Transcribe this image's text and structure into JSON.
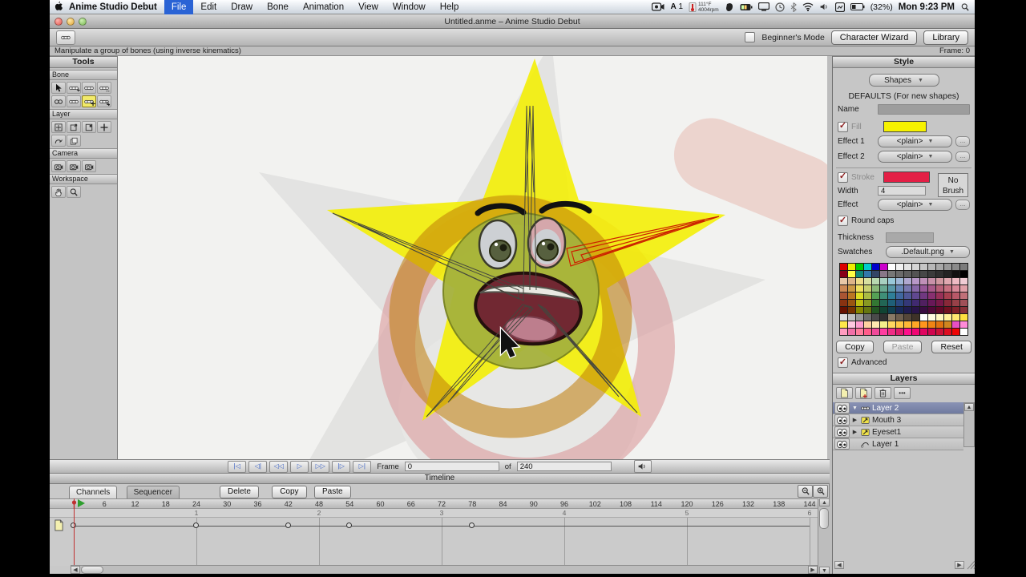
{
  "menu_bar": {
    "app_name": "Anime Studio Debut",
    "items": [
      {
        "label": "File",
        "selected": true
      },
      {
        "label": "Edit"
      },
      {
        "label": "Draw"
      },
      {
        "label": "Bone"
      },
      {
        "label": "Animation"
      },
      {
        "label": "View"
      },
      {
        "label": "Window"
      },
      {
        "label": "Help"
      }
    ],
    "status": {
      "adobe_label": "A",
      "adobe_count": "1",
      "temp_line1": "111°F",
      "temp_line2": "4004rpm",
      "battery_pct": "(32%)",
      "clock": "Mon 9:23 PM"
    }
  },
  "window": {
    "title": "Untitled.anme – Anime Studio Debut"
  },
  "toolbar": {
    "beginners_mode_label": "Beginner's Mode",
    "character_wizard_label": "Character Wizard",
    "library_label": "Library"
  },
  "status_bar": {
    "message": "Manipulate a group of bones (using inverse kinematics)",
    "frame_label": "Frame: 0"
  },
  "tools_panel": {
    "title": "Tools",
    "sections": [
      {
        "label": "Bone",
        "rows": [
          [
            {
              "name": "select-bone-tool",
              "sym": "cursor"
            },
            {
              "name": "translate-bone-tool",
              "sym": "bone",
              "badge": "+"
            },
            {
              "name": "rotate-bone-tool",
              "sym": "bone"
            },
            {
              "name": "scale-bone-tool",
              "sym": "bone",
              "badge": "↔"
            }
          ],
          [
            {
              "name": "add-bone-tool",
              "sym": "chain"
            },
            {
              "name": "bone-strength-tool",
              "sym": "bone"
            },
            {
              "name": "manipulate-bones-tool",
              "sym": "bone",
              "badge": "✛",
              "highlighted": true
            },
            {
              "name": "reparent-bone-tool",
              "sym": "bone",
              "badge": "↳"
            }
          ]
        ]
      },
      {
        "label": "Layer",
        "rows": [
          [
            {
              "name": "translate-layer-tool",
              "sym": "squarecross"
            },
            {
              "name": "rotate-layer-tool",
              "sym": "squarearrow"
            },
            {
              "name": "scale-layer-tool",
              "sym": "squaresmall"
            },
            {
              "name": "add-layer-tool",
              "sym": "plus"
            }
          ],
          [
            {
              "name": "rotate-layer-z-tool",
              "sym": "curvearrow"
            },
            {
              "name": "layer-order-tool",
              "sym": "layers"
            }
          ]
        ]
      },
      {
        "label": "Camera",
        "rows": [
          [
            {
              "name": "track-camera-tool",
              "sym": "camera"
            },
            {
              "name": "pan-camera-tool",
              "sym": "camera"
            },
            {
              "name": "roll-camera-tool",
              "sym": "camera"
            }
          ]
        ]
      },
      {
        "label": "Workspace",
        "rows": [
          [
            {
              "name": "pan-workspace-tool",
              "sym": "hand"
            },
            {
              "name": "zoom-workspace-tool",
              "sym": "magnifier"
            }
          ]
        ]
      }
    ]
  },
  "style_panel": {
    "title": "Style",
    "shapes_dropdown": "Shapes",
    "defaults_heading": "DEFAULTS (For new shapes)",
    "name_label": "Name",
    "fill_label": "Fill",
    "fill_color": "#f6f200",
    "effect1_label": "Effect 1",
    "effect1_value": "<plain>",
    "effect2_label": "Effect 2",
    "effect2_value": "<plain>",
    "stroke_label": "Stroke",
    "stroke_color": "#e31f45",
    "no_brush_line1": "No",
    "no_brush_line2": "Brush",
    "width_label": "Width",
    "width_value": "4",
    "effect_label": "Effect",
    "effect_value": "<plain>",
    "round_caps_label": "Round caps",
    "thickness_label": "Thickness",
    "swatches_label": "Swatches",
    "swatches_value": ".Default.png",
    "copy_label": "Copy",
    "paste_label": "Paste",
    "reset_label": "Reset",
    "advanced_label": "Advanced",
    "ellipsis": "..."
  },
  "palette_rows": [
    [
      "#dd0000",
      "#eeee00",
      "#00cc00",
      "#00cccc",
      "#0000cc",
      "#cc00cc",
      "#ffffff",
      "#f2f2f2",
      "#e4e4e4",
      "#d5d5d5",
      "#c6c6c6",
      "#b7b7b7",
      "#a8a8a8",
      "#999999",
      "#8a8a8a",
      "#7b7b7b"
    ],
    [
      "#880018",
      "#ffff44",
      "#118877",
      "#3377aa",
      "#334466",
      "#887788",
      "#777777",
      "#6b6b6b",
      "#5f5f5f",
      "#535353",
      "#474747",
      "#3b3b3b",
      "#2f2f2f",
      "#232323",
      "#111111",
      "#000000"
    ],
    [
      "#e8c8a8",
      "#ddb488",
      "#eedd88",
      "#d8e0a0",
      "#b8d8b0",
      "#a8d0c0",
      "#98c8d8",
      "#a0b8d8",
      "#b0a8d0",
      "#b898c8",
      "#c090b8",
      "#c890a8",
      "#d098a0",
      "#e0a8b0",
      "#eebbc4",
      "#f0ccd4"
    ],
    [
      "#cc8855",
      "#cc9944",
      "#eee060",
      "#c8d070",
      "#88b878",
      "#68a890",
      "#5898a8",
      "#6888b8",
      "#7878b0",
      "#8868a8",
      "#985898",
      "#a85888",
      "#b86078",
      "#c87080",
      "#d88898",
      "#e0a0a8"
    ],
    [
      "#aa5533",
      "#bb7722",
      "#dddd22",
      "#aabb44",
      "#55a055",
      "#3f8f78",
      "#2f7f98",
      "#4068a0",
      "#505898",
      "#604890",
      "#703880",
      "#883070",
      "#983058",
      "#a84050",
      "#b85868",
      "#c07078"
    ],
    [
      "#883311",
      "#995511",
      "#bbbb11",
      "#889922",
      "#337733",
      "#226655",
      "#1f5f78",
      "#2a4880",
      "#343878",
      "#402a70",
      "#502060",
      "#681858",
      "#781848",
      "#882838",
      "#984048",
      "#a05058"
    ],
    [
      "#661100",
      "#773300",
      "#888800",
      "#667711",
      "#225522",
      "#114433",
      "#103f50",
      "#182858",
      "#201c50",
      "#281448",
      "#380c40",
      "#500838",
      "#600828",
      "#701020",
      "#802028",
      "#883038"
    ],
    [
      "#dddddd",
      "#c0c0c0",
      "#9a9a9a",
      "#6e6e6e",
      "#4a4a4a",
      "#303030",
      "#8a7a66",
      "#6e5e4e",
      "#554639",
      "#3e3228",
      "#ffffff",
      "#fffbe0",
      "#fff6c0",
      "#ffef9a",
      "#ffe770",
      "#ffe040"
    ],
    [
      "#ffe84a",
      "#ffc8e0",
      "#ff9ed0",
      "#ffd2a0",
      "#ffe9b0",
      "#f4ee8a",
      "#ffd760",
      "#ffc847",
      "#ffb836",
      "#ffa726",
      "#ff961d",
      "#f08414",
      "#e07310",
      "#d0861f",
      "#e84fc4",
      "#ff8ad8"
    ],
    [
      "#ff9cc0",
      "#f070a8",
      "#ff7d9d",
      "#ff5c8a",
      "#f04a9a",
      "#ff3da0",
      "#f02d86",
      "#e01c6e",
      "#ff0f8c",
      "#f00573",
      "#e00560",
      "#d0054e",
      "#cc1038",
      "#dd0d20",
      "#ee0505",
      "#ffffff"
    ]
  ],
  "layers_panel": {
    "title": "Layers",
    "rows": [
      {
        "label": "Layer 2",
        "type": "bone",
        "expander": "open",
        "selected": true
      },
      {
        "label": "Mouth 3",
        "type": "switch",
        "expander": "closed"
      },
      {
        "label": "Eyeset1",
        "type": "switch",
        "expander": "closed"
      },
      {
        "label": "Layer 1",
        "type": "vector",
        "expander": "none"
      }
    ]
  },
  "playback": {
    "buttons": [
      {
        "name": "jump-start-button",
        "glyph": "|◁"
      },
      {
        "name": "prev-keyframe-button",
        "glyph": "◁|"
      },
      {
        "name": "step-back-button",
        "glyph": "◁◁"
      },
      {
        "name": "play-button",
        "glyph": "▷"
      },
      {
        "name": "step-forward-button",
        "glyph": "▷▷"
      },
      {
        "name": "next-keyframe-button",
        "glyph": "|▷"
      },
      {
        "name": "jump-end-button",
        "glyph": "▷|"
      }
    ],
    "frame_label": "Frame",
    "frame_value": "0",
    "of_label": "of",
    "total_frames": "240"
  },
  "timeline": {
    "title": "Timeline",
    "tabs": [
      {
        "label": "Channels",
        "active": true
      },
      {
        "label": "Sequencer",
        "active": false
      }
    ],
    "buttons": [
      "Delete",
      "Copy",
      "Paste"
    ],
    "ruler_labels": [
      6,
      12,
      18,
      24,
      30,
      36,
      42,
      48,
      54,
      60,
      66,
      72,
      78,
      84,
      90,
      96,
      102,
      108,
      114,
      120,
      126,
      132,
      138,
      144
    ],
    "seconds": [
      {
        "label": "1",
        "frame": 24
      },
      {
        "label": "2",
        "frame": 48
      },
      {
        "label": "3",
        "frame": 72
      },
      {
        "label": "4",
        "frame": 96
      },
      {
        "label": "5",
        "frame": 120
      },
      {
        "label": "6",
        "frame": 144
      }
    ],
    "keyframes": [
      0,
      24,
      42,
      54,
      78
    ],
    "current_frame": 0
  }
}
